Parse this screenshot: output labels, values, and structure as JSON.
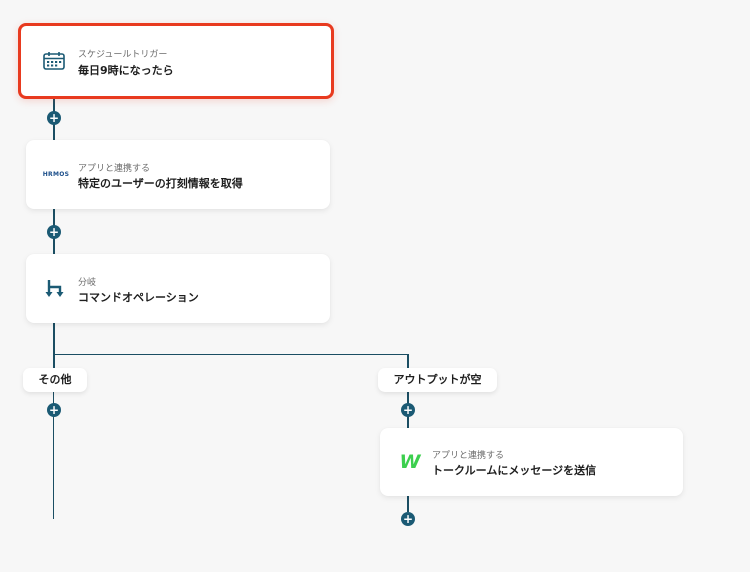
{
  "flow": {
    "trigger": {
      "subtitle": "スケジュールトリガー",
      "title": "毎日9時になったら",
      "icon": "calendar-icon"
    },
    "step1": {
      "subtitle": "アプリと連携する",
      "title": "特定のユーザーの打刻情報を取得",
      "icon": "hrmos-logo",
      "logo_text": "HRMOS"
    },
    "step2": {
      "subtitle": "分岐",
      "title": "コマンドオペレーション",
      "icon": "branch-icon"
    },
    "branches": {
      "left": {
        "label": "その他"
      },
      "right": {
        "label": "アウトプットが空"
      }
    },
    "step3": {
      "subtitle": "アプリと連携する",
      "title": "トークルームにメッセージを送信",
      "icon": "lineworks-logo",
      "logo_text": "W"
    },
    "add_symbol": "+"
  },
  "colors": {
    "connector": "#1b4e63",
    "selected_border": "#e83a1f",
    "plus_bg": "#1b5a74"
  }
}
